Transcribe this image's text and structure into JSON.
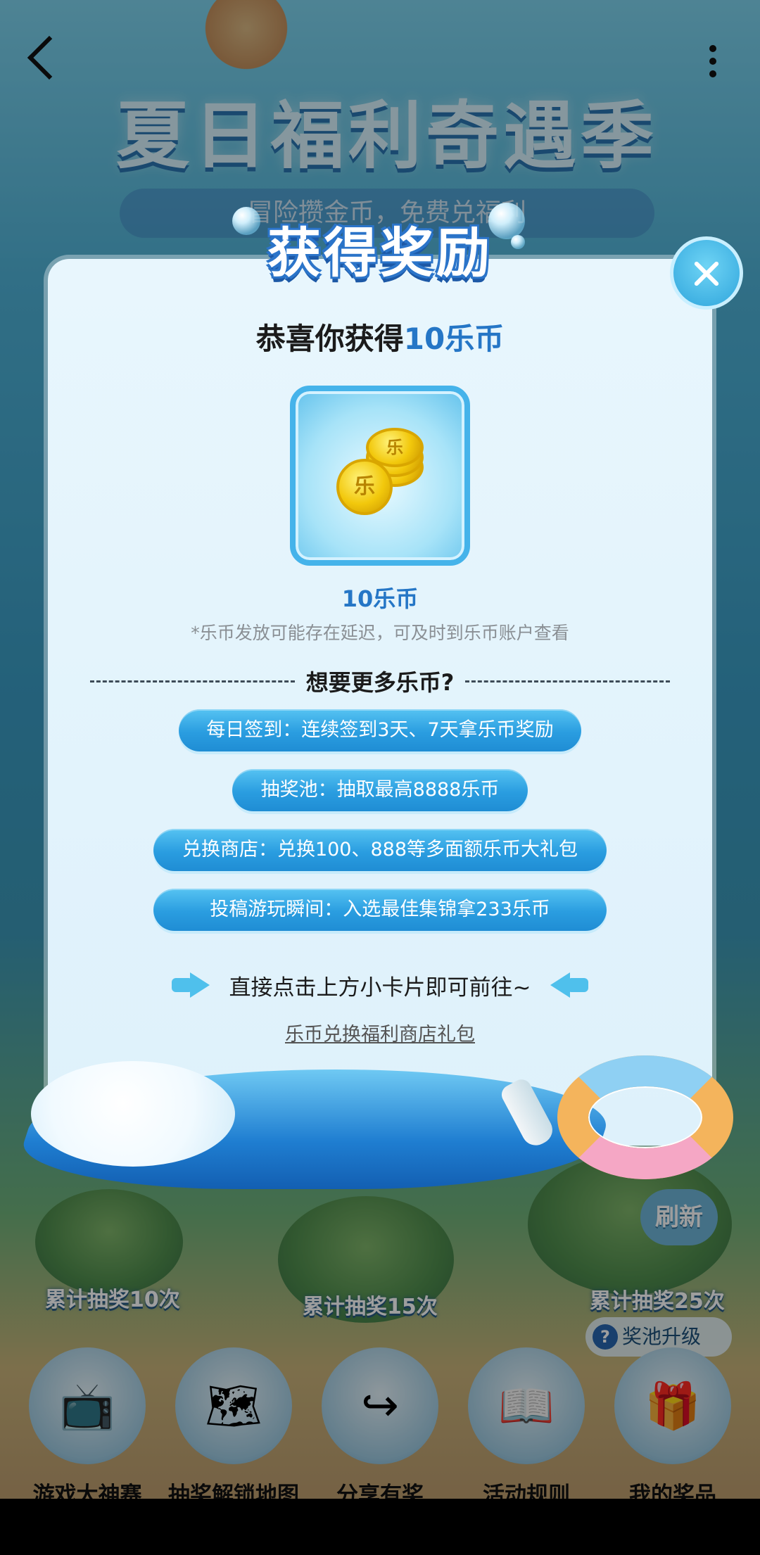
{
  "background": {
    "banner_title": "夏日福利奇遇季",
    "banner_subtitle": "冒险攒金币，免费兑福利",
    "islands": [
      {
        "label": "累计抽奖10次"
      },
      {
        "label": "累计抽奖15次"
      },
      {
        "label": "累计抽奖25次"
      }
    ],
    "refresh_label": "刷新",
    "pool_upgrade_label": "奖池升级",
    "bottom_nav": [
      {
        "label": "游戏大神赛",
        "icon": "tv-icon"
      },
      {
        "label": "抽奖解锁地图",
        "icon": "map-icon"
      },
      {
        "label": "分享有奖",
        "icon": "share-icon"
      },
      {
        "label": "活动规则",
        "icon": "book-icon"
      },
      {
        "label": "我的奖品",
        "icon": "gift-icon"
      }
    ]
  },
  "modal": {
    "title": "获得奖励",
    "congrats_prefix": "恭喜你获得",
    "congrats_highlight": "10乐币",
    "reward_name": "10乐币",
    "reward_note": "*乐币发放可能存在延迟，可及时到乐币账户查看",
    "divider_text": "想要更多乐币?",
    "options": [
      "每日签到：连续签到3天、7天拿乐币奖励",
      "抽奖池：抽取最高8888乐币",
      "兑换商店：兑换100、888等多面额乐币大礼包",
      "投稿游玩瞬间：入选最佳集锦拿233乐币"
    ],
    "hint": "直接点击上方小卡片即可前往~",
    "shop_link": "乐币兑换福利商店礼包",
    "coin_glyph": "乐"
  },
  "colors": {
    "accent_blue": "#2576c6",
    "pill_blue": "#2a9de0",
    "modal_bg": "#e8f6fd"
  }
}
